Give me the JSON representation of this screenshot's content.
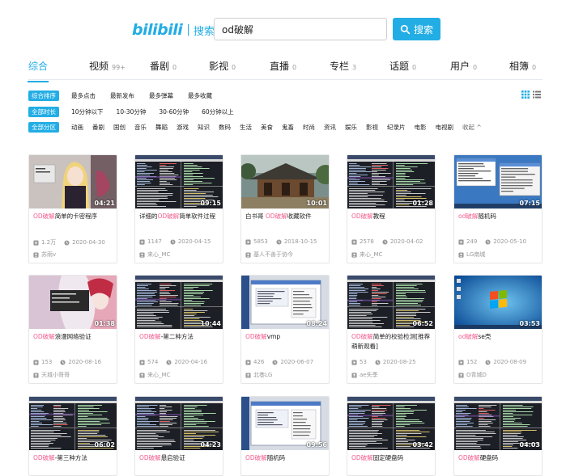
{
  "brand": {
    "logo": "bilibili",
    "separator": "|",
    "subtitle": "搜索"
  },
  "search": {
    "query": "od破解",
    "button_label": "搜索"
  },
  "tabs": [
    {
      "label": "综合",
      "count": "",
      "active": true
    },
    {
      "label": "视频",
      "count": "99+"
    },
    {
      "label": "番剧",
      "count": "0"
    },
    {
      "label": "影视",
      "count": "0"
    },
    {
      "label": "直播",
      "count": "0"
    },
    {
      "label": "专栏",
      "count": "3"
    },
    {
      "label": "话题",
      "count": "0"
    },
    {
      "label": "用户",
      "count": "0"
    },
    {
      "label": "相簿",
      "count": "0"
    }
  ],
  "filters": {
    "sort": {
      "chip": "综合排序",
      "options": [
        "最多点击",
        "最新发布",
        "最多弹幕",
        "最多收藏"
      ]
    },
    "duration": {
      "chip": "全部时长",
      "options": [
        "10分钟以下",
        "10-30分钟",
        "30-60分钟",
        "60分钟以上"
      ]
    },
    "zone": {
      "chip": "全部分区",
      "options": [
        "动画",
        "番剧",
        "国创",
        "音乐",
        "舞蹈",
        "游戏",
        "知识",
        "数码",
        "生活",
        "美食",
        "鬼畜",
        "时尚",
        "资讯",
        "娱乐",
        "影视",
        "纪录片",
        "电影",
        "电视剧"
      ],
      "collapse": "收起 ^"
    }
  },
  "videos": [
    {
      "thumb": "anime",
      "duration": "04:21",
      "highlight": "OD破解",
      "rest": "简单的卡密程序",
      "plays": "1.2万",
      "date": "2020-04-30",
      "uploader": "苏雨v"
    },
    {
      "thumb": "debugger",
      "duration": "09:15",
      "highlight": "OD破解",
      "prefix": "详细的",
      "rest": "简单软件过程",
      "plays": "1147",
      "date": "2020-04-15",
      "uploader": "来心_MC"
    },
    {
      "thumb": "temple",
      "duration": "10:01",
      "highlight": "OD破解",
      "prefix": "白书哥 ",
      "rest": "收藏软件",
      "plays": "5853",
      "date": "2018-10-15",
      "uploader": "基人不善于协今"
    },
    {
      "thumb": "debugger",
      "duration": "01:28",
      "highlight": "OD破解",
      "rest": "教程",
      "plays": "2578",
      "date": "2020-04-02",
      "uploader": "来心_MC"
    },
    {
      "thumb": "desktop",
      "duration": "07:15",
      "highlight": "od破解",
      "rest": "随机码",
      "plays": "249",
      "date": "2020-05-10",
      "uploader": "LG南城"
    },
    {
      "thumb": "anime2",
      "duration": "01:38",
      "highlight": "OD破解",
      "rest": "浪漫网络验证",
      "plays": "153",
      "date": "2020-08-16",
      "uploader": "天城小哥哥"
    },
    {
      "thumb": "debugger",
      "duration": "10:44",
      "highlight": "OD破解",
      "rest": "-第二种方法",
      "plays": "574",
      "date": "2020-04-16",
      "uploader": "来心_MC"
    },
    {
      "thumb": "window",
      "duration": "08:24",
      "highlight": "OD破解",
      "rest": "vmp",
      "plays": "426",
      "date": "2020-06-07",
      "uploader": "北巷LG"
    },
    {
      "thumb": "debugger",
      "duration": "06:52",
      "highlight": "OD破解",
      "rest": "简单的校验检测[推荐萌新观看]",
      "plays": "53",
      "date": "2020-08-25",
      "uploader": "ae失季"
    },
    {
      "thumb": "win7",
      "duration": "03:53",
      "highlight": "od破解",
      "rest": "se壳",
      "plays": "152",
      "date": "2020-08-09",
      "uploader": "O青城D"
    },
    {
      "thumb": "debugger",
      "duration": "06:02",
      "highlight": "OD破解",
      "rest": "-第三种方法"
    },
    {
      "thumb": "debugger",
      "duration": "04:23",
      "highlight": "OD破解",
      "rest": "悬启验证"
    },
    {
      "thumb": "window",
      "duration": "09:56",
      "highlight": "OD破解",
      "rest": "随机码"
    },
    {
      "thumb": "debugger",
      "duration": "03:42",
      "highlight": "OD破解",
      "rest": "固定硬盘码"
    },
    {
      "thumb": "debugger",
      "duration": "04:03",
      "highlight": "OD破解",
      "rest": "硬盘码"
    }
  ]
}
